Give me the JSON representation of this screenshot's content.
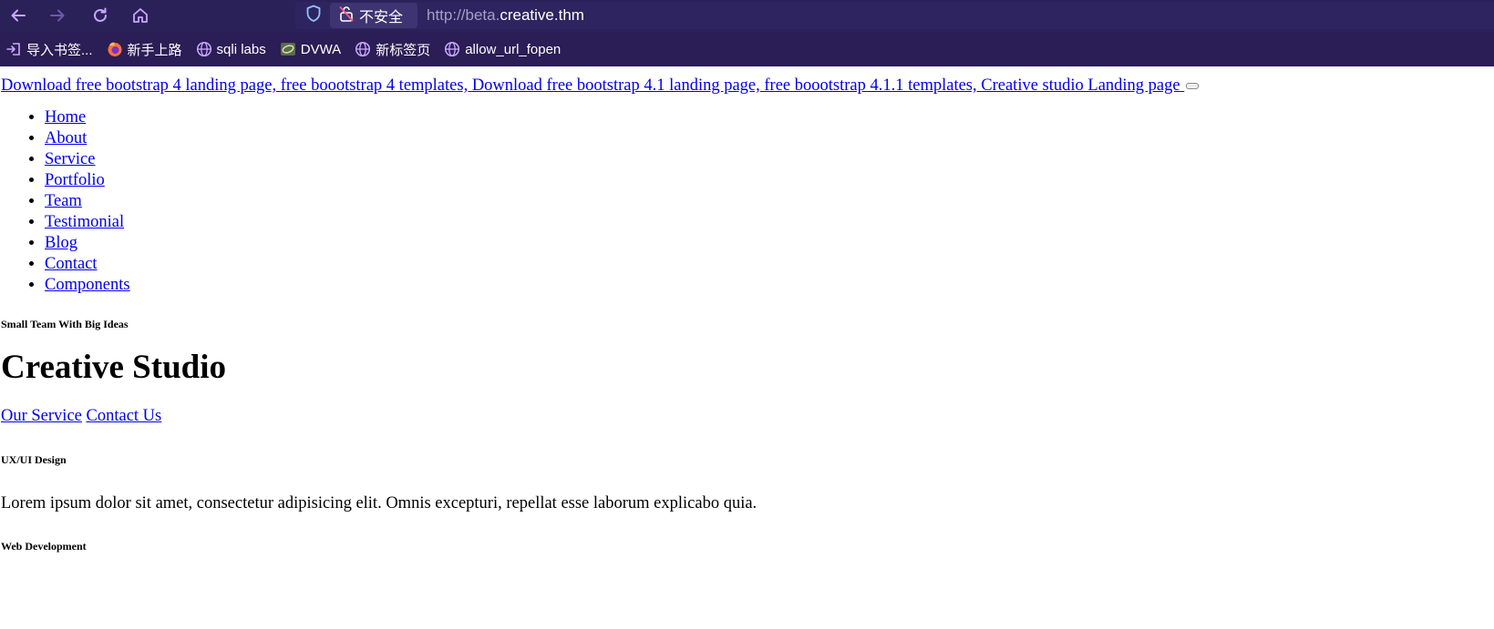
{
  "browser": {
    "url_scheme": "http://beta.",
    "url_host": "creative.thm",
    "security_label": "不安全"
  },
  "bookmarks": [
    {
      "label": "导入书签...",
      "icon": "import-icon"
    },
    {
      "label": "新手上路",
      "icon": "firefox-icon"
    },
    {
      "label": "sqli labs",
      "icon": "globe-icon"
    },
    {
      "label": "DVWA",
      "icon": "dvwa-icon"
    },
    {
      "label": "新标签页",
      "icon": "globe-icon"
    },
    {
      "label": "allow_url_fopen",
      "icon": "globe-icon"
    }
  ],
  "page": {
    "brand_link": "Download free bootstrap 4 landing page, free boootstrap 4 templates, Download free bootstrap 4.1 landing page, free boootstrap 4.1.1 templates, Creative studio Landing page",
    "menu": [
      "Home",
      "About",
      "Service",
      "Portfolio",
      "Team",
      "Testimonial",
      "Blog",
      "Contact",
      "Components"
    ],
    "tagline": "Small Team With Big Ideas",
    "hero_title": "Creative Studio",
    "cta_service": "Our Service",
    "cta_contact": "Contact Us",
    "services": [
      {
        "title": "UX/UI Design",
        "text": "Lorem ipsum dolor sit amet, consectetur adipisicing elit. Omnis excepturi, repellat esse laborum explicabo quia."
      },
      {
        "title": "Web Development"
      }
    ]
  },
  "colors": {
    "toolbar_bg": "#2b2159",
    "bookmarks_bg": "#2b1d55",
    "link": "#0000ee",
    "accent_icon": "#c9a7ff"
  }
}
